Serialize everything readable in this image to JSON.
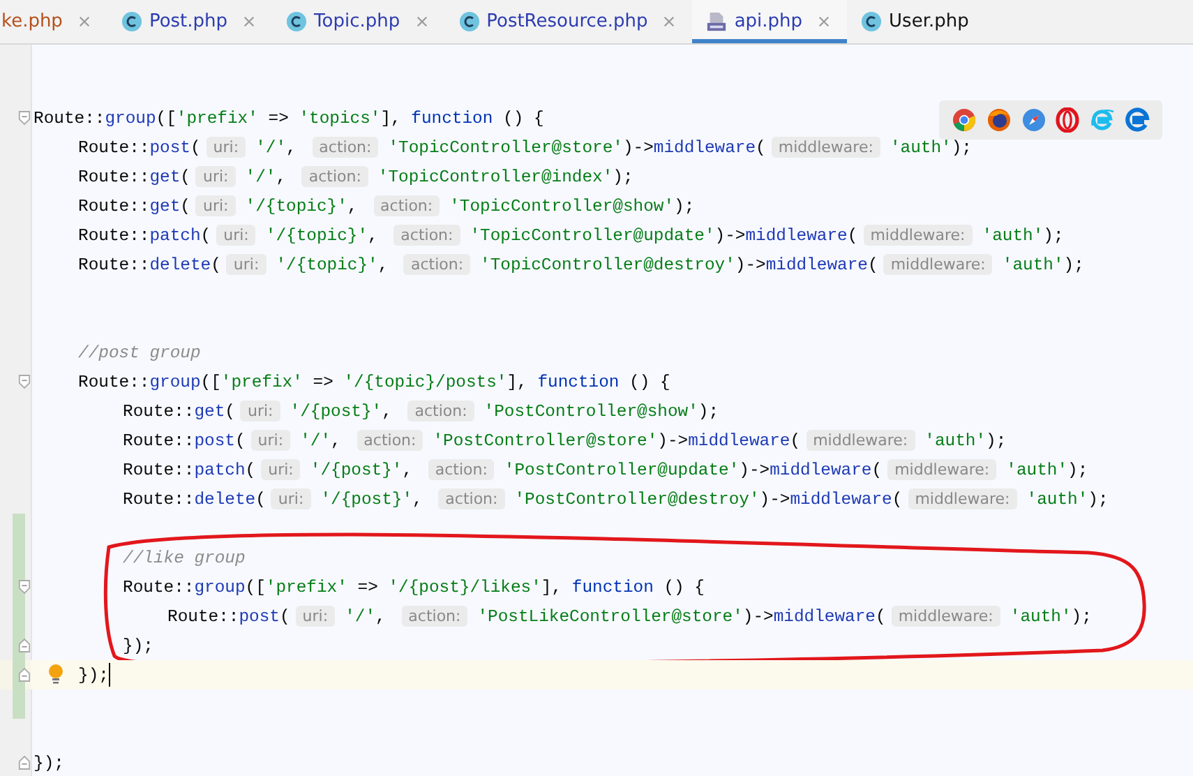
{
  "tabs": [
    {
      "label": "ke.php",
      "kind": "plain",
      "color": "#b5501c",
      "selected": false,
      "closable": true
    },
    {
      "label": "Post.php",
      "kind": "class",
      "color": "#2c3cb0",
      "selected": false,
      "closable": true
    },
    {
      "label": "Topic.php",
      "kind": "class",
      "color": "#2c3cb0",
      "selected": false,
      "closable": true
    },
    {
      "label": "PostResource.php",
      "kind": "class",
      "color": "#2c3cb0",
      "selected": false,
      "closable": true
    },
    {
      "label": "api.php",
      "kind": "php",
      "color": "#2c3cb0",
      "selected": true,
      "closable": true
    },
    {
      "label": "User.php",
      "kind": "class",
      "color": "#111111",
      "selected": false,
      "closable": false
    }
  ],
  "editor": {
    "lines": [
      {
        "kind": "blank",
        "changed": false,
        "current": false
      },
      {
        "kind": "blank",
        "changed": false,
        "current": false
      },
      {
        "kind": "code",
        "changed": false,
        "current": false,
        "tokens": [
          {
            "kind": "plain",
            "text": "Route::"
          },
          {
            "kind": "method",
            "text": "group"
          },
          {
            "kind": "plain",
            "text": "(["
          },
          {
            "kind": "string",
            "text": "'prefix'"
          },
          {
            "kind": "plain",
            "text": " => "
          },
          {
            "kind": "string",
            "text": "'topics'"
          },
          {
            "kind": "plain",
            "text": "], "
          },
          {
            "kind": "keyword",
            "text": "function"
          },
          {
            "kind": "plain",
            "text": " () {"
          }
        ],
        "children": [
          {
            "kind": "code",
            "changed": false,
            "current": false,
            "tokens": [
              {
                "kind": "plain",
                "text": "Route::"
              },
              {
                "kind": "method",
                "text": "post"
              },
              {
                "kind": "plain",
                "text": "("
              },
              {
                "kind": "hint",
                "text": "uri:"
              },
              {
                "kind": "string",
                "text": "'/'"
              },
              {
                "kind": "plain",
                "text": ", "
              },
              {
                "kind": "hint",
                "text": "action:"
              },
              {
                "kind": "string",
                "text": "'TopicController@store'"
              },
              {
                "kind": "plain",
                "text": ")->"
              },
              {
                "kind": "method",
                "text": "middleware"
              },
              {
                "kind": "plain",
                "text": "("
              },
              {
                "kind": "hint",
                "text": "middleware:"
              },
              {
                "kind": "string",
                "text": "'auth'"
              },
              {
                "kind": "plain",
                "text": ");"
              }
            ]
          },
          {
            "kind": "code",
            "changed": false,
            "current": false,
            "tokens": [
              {
                "kind": "plain",
                "text": "Route::"
              },
              {
                "kind": "method",
                "text": "get"
              },
              {
                "kind": "plain",
                "text": "("
              },
              {
                "kind": "hint",
                "text": "uri:"
              },
              {
                "kind": "string",
                "text": "'/'"
              },
              {
                "kind": "plain",
                "text": ", "
              },
              {
                "kind": "hint",
                "text": "action:"
              },
              {
                "kind": "string",
                "text": "'TopicController@index'"
              },
              {
                "kind": "plain",
                "text": ");"
              }
            ]
          },
          {
            "kind": "code",
            "changed": false,
            "current": false,
            "tokens": [
              {
                "kind": "plain",
                "text": "Route::"
              },
              {
                "kind": "method",
                "text": "get"
              },
              {
                "kind": "plain",
                "text": "("
              },
              {
                "kind": "hint",
                "text": "uri:"
              },
              {
                "kind": "string",
                "text": "'/{topic}'"
              },
              {
                "kind": "plain",
                "text": ", "
              },
              {
                "kind": "hint",
                "text": "action:"
              },
              {
                "kind": "string",
                "text": "'TopicController@show'"
              },
              {
                "kind": "plain",
                "text": ");"
              }
            ]
          },
          {
            "kind": "code",
            "changed": false,
            "current": false,
            "tokens": [
              {
                "kind": "plain",
                "text": "Route::"
              },
              {
                "kind": "method",
                "text": "patch"
              },
              {
                "kind": "plain",
                "text": "("
              },
              {
                "kind": "hint",
                "text": "uri:"
              },
              {
                "kind": "string",
                "text": "'/{topic}'"
              },
              {
                "kind": "plain",
                "text": ", "
              },
              {
                "kind": "hint",
                "text": "action:"
              },
              {
                "kind": "string",
                "text": "'TopicController@update'"
              },
              {
                "kind": "plain",
                "text": ")->"
              },
              {
                "kind": "method",
                "text": "middleware"
              },
              {
                "kind": "plain",
                "text": "("
              },
              {
                "kind": "hint",
                "text": "middleware:"
              },
              {
                "kind": "string",
                "text": "'auth'"
              },
              {
                "kind": "plain",
                "text": ");"
              }
            ]
          },
          {
            "kind": "code",
            "changed": false,
            "current": false,
            "tokens": [
              {
                "kind": "plain",
                "text": "Route::"
              },
              {
                "kind": "method",
                "text": "delete"
              },
              {
                "kind": "plain",
                "text": "("
              },
              {
                "kind": "hint",
                "text": "uri:"
              },
              {
                "kind": "string",
                "text": "'/{topic}'"
              },
              {
                "kind": "plain",
                "text": ", "
              },
              {
                "kind": "hint",
                "text": "action:"
              },
              {
                "kind": "string",
                "text": "'TopicController@destroy'"
              },
              {
                "kind": "plain",
                "text": ")->"
              },
              {
                "kind": "method",
                "text": "middleware"
              },
              {
                "kind": "plain",
                "text": "("
              },
              {
                "kind": "hint",
                "text": "middleware:"
              },
              {
                "kind": "string",
                "text": "'auth'"
              },
              {
                "kind": "plain",
                "text": ");"
              }
            ]
          },
          {
            "kind": "blank",
            "changed": false,
            "current": false
          },
          {
            "kind": "blank",
            "changed": false,
            "current": false
          },
          {
            "kind": "code",
            "changed": false,
            "current": false,
            "tokens": [
              {
                "kind": "comment",
                "text": "//post group"
              }
            ]
          },
          {
            "kind": "code",
            "changed": false,
            "current": false,
            "tokens": [
              {
                "kind": "plain",
                "text": "Route::"
              },
              {
                "kind": "method",
                "text": "group"
              },
              {
                "kind": "plain",
                "text": "(["
              },
              {
                "kind": "string",
                "text": "'prefix'"
              },
              {
                "kind": "plain",
                "text": " => "
              },
              {
                "kind": "string",
                "text": "'/{topic}/posts'"
              },
              {
                "kind": "plain",
                "text": "], "
              },
              {
                "kind": "keyword",
                "text": "function"
              },
              {
                "kind": "plain",
                "text": " () {"
              }
            ],
            "children": [
              {
                "kind": "code",
                "changed": false,
                "current": false,
                "tokens": [
                  {
                    "kind": "plain",
                    "text": "Route::"
                  },
                  {
                    "kind": "method",
                    "text": "get"
                  },
                  {
                    "kind": "plain",
                    "text": "("
                  },
                  {
                    "kind": "hint",
                    "text": "uri:"
                  },
                  {
                    "kind": "string",
                    "text": "'/{post}'"
                  },
                  {
                    "kind": "plain",
                    "text": ", "
                  },
                  {
                    "kind": "hint",
                    "text": "action:"
                  },
                  {
                    "kind": "string",
                    "text": "'PostController@show'"
                  },
                  {
                    "kind": "plain",
                    "text": ");"
                  }
                ]
              },
              {
                "kind": "code",
                "changed": false,
                "current": false,
                "tokens": [
                  {
                    "kind": "plain",
                    "text": "Route::"
                  },
                  {
                    "kind": "method",
                    "text": "post"
                  },
                  {
                    "kind": "plain",
                    "text": "("
                  },
                  {
                    "kind": "hint",
                    "text": "uri:"
                  },
                  {
                    "kind": "string",
                    "text": "'/'"
                  },
                  {
                    "kind": "plain",
                    "text": ", "
                  },
                  {
                    "kind": "hint",
                    "text": "action:"
                  },
                  {
                    "kind": "string",
                    "text": "'PostController@store'"
                  },
                  {
                    "kind": "plain",
                    "text": ")->"
                  },
                  {
                    "kind": "method",
                    "text": "middleware"
                  },
                  {
                    "kind": "plain",
                    "text": "("
                  },
                  {
                    "kind": "hint",
                    "text": "middleware:"
                  },
                  {
                    "kind": "string",
                    "text": "'auth'"
                  },
                  {
                    "kind": "plain",
                    "text": ");"
                  }
                ]
              },
              {
                "kind": "code",
                "changed": false,
                "current": false,
                "tokens": [
                  {
                    "kind": "plain",
                    "text": "Route::"
                  },
                  {
                    "kind": "method",
                    "text": "patch"
                  },
                  {
                    "kind": "plain",
                    "text": "("
                  },
                  {
                    "kind": "hint",
                    "text": "uri:"
                  },
                  {
                    "kind": "string",
                    "text": "'/{post}'"
                  },
                  {
                    "kind": "plain",
                    "text": ", "
                  },
                  {
                    "kind": "hint",
                    "text": "action:"
                  },
                  {
                    "kind": "string",
                    "text": "'PostController@update'"
                  },
                  {
                    "kind": "plain",
                    "text": ")->"
                  },
                  {
                    "kind": "method",
                    "text": "middleware"
                  },
                  {
                    "kind": "plain",
                    "text": "("
                  },
                  {
                    "kind": "hint",
                    "text": "middleware:"
                  },
                  {
                    "kind": "string",
                    "text": "'auth'"
                  },
                  {
                    "kind": "plain",
                    "text": ");"
                  }
                ]
              },
              {
                "kind": "code",
                "changed": false,
                "current": false,
                "tokens": [
                  {
                    "kind": "plain",
                    "text": "Route::"
                  },
                  {
                    "kind": "method",
                    "text": "delete"
                  },
                  {
                    "kind": "plain",
                    "text": "("
                  },
                  {
                    "kind": "hint",
                    "text": "uri:"
                  },
                  {
                    "kind": "string",
                    "text": "'/{post}'"
                  },
                  {
                    "kind": "plain",
                    "text": ", "
                  },
                  {
                    "kind": "hint",
                    "text": "action:"
                  },
                  {
                    "kind": "string",
                    "text": "'PostController@destroy'"
                  },
                  {
                    "kind": "plain",
                    "text": ")->"
                  },
                  {
                    "kind": "method",
                    "text": "middleware"
                  },
                  {
                    "kind": "plain",
                    "text": "("
                  },
                  {
                    "kind": "hint",
                    "text": "middleware:"
                  },
                  {
                    "kind": "string",
                    "text": "'auth'"
                  },
                  {
                    "kind": "plain",
                    "text": ");"
                  }
                ]
              },
              {
                "kind": "blank",
                "changed": true,
                "current": false
              },
              {
                "kind": "code",
                "changed": true,
                "current": false,
                "tokens": [
                  {
                    "kind": "comment",
                    "text": "//like group"
                  }
                ]
              },
              {
                "kind": "code",
                "changed": true,
                "current": false,
                "tokens": [
                  {
                    "kind": "plain",
                    "text": "Route::"
                  },
                  {
                    "kind": "method",
                    "text": "group"
                  },
                  {
                    "kind": "plain",
                    "text": "(["
                  },
                  {
                    "kind": "string",
                    "text": "'prefix'"
                  },
                  {
                    "kind": "plain",
                    "text": " => "
                  },
                  {
                    "kind": "string",
                    "text": "'/{post}/likes'"
                  },
                  {
                    "kind": "plain",
                    "text": "], "
                  },
                  {
                    "kind": "keyword",
                    "text": "function"
                  },
                  {
                    "kind": "plain",
                    "text": " () {"
                  }
                ],
                "children": [
                  {
                    "kind": "code",
                    "changed": true,
                    "current": false,
                    "tokens": [
                      {
                        "kind": "plain",
                        "text": "Route::"
                      },
                      {
                        "kind": "method",
                        "text": "post"
                      },
                      {
                        "kind": "plain",
                        "text": "("
                      },
                      {
                        "kind": "hint",
                        "text": "uri:"
                      },
                      {
                        "kind": "string",
                        "text": "'/'"
                      },
                      {
                        "kind": "plain",
                        "text": ", "
                      },
                      {
                        "kind": "hint",
                        "text": "action:"
                      },
                      {
                        "kind": "string",
                        "text": "'PostLikeController@store'"
                      },
                      {
                        "kind": "plain",
                        "text": ")->"
                      },
                      {
                        "kind": "method",
                        "text": "middleware"
                      },
                      {
                        "kind": "plain",
                        "text": "("
                      },
                      {
                        "kind": "hint",
                        "text": "middleware:"
                      },
                      {
                        "kind": "string",
                        "text": "'auth'"
                      },
                      {
                        "kind": "plain",
                        "text": ");"
                      }
                    ]
                  }
                ],
                "closing": {
                  "changed": true,
                  "current": false,
                  "tokens": [
                    {
                      "kind": "plain",
                      "text": "});"
                    }
                  ]
                }
              }
            ],
            "closing": {
              "changed": true,
              "current": true,
              "tokens": [
                {
                  "kind": "plain",
                  "text": "});"
                }
              ]
            }
          },
          {
            "kind": "blank",
            "changed": true,
            "current": false
          },
          {
            "kind": "blank",
            "changed": false,
            "current": false
          }
        ],
        "closing": {
          "changed": false,
          "current": false,
          "tokens": [
            {
              "kind": "plain",
              "text": "});"
            }
          ]
        }
      }
    ]
  }
}
